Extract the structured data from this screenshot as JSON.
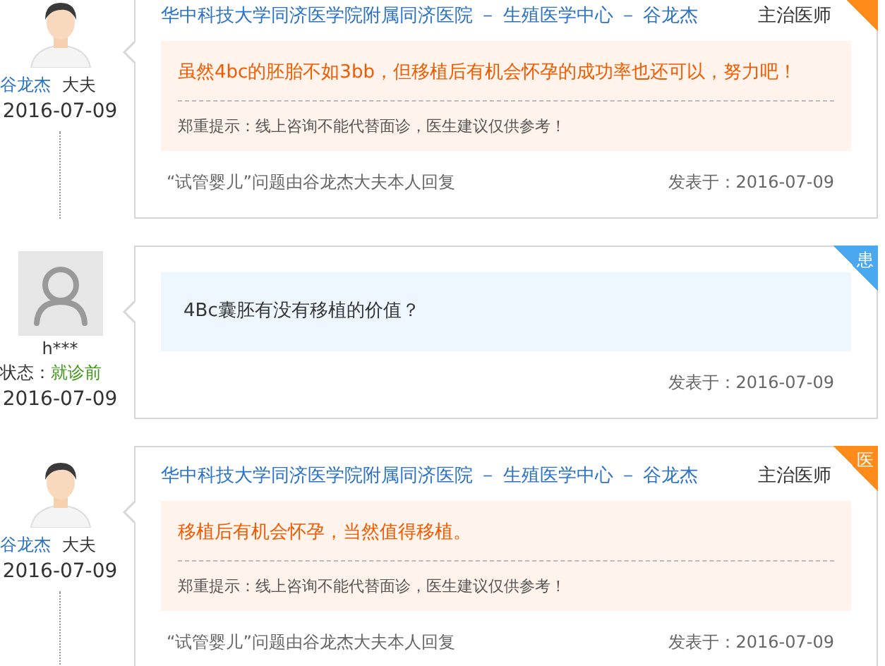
{
  "entries": [
    {
      "kind": "doctor",
      "name": "谷龙杰",
      "role": "大夫",
      "date": "2016-07-09",
      "hospital": "华中科技大学同济医学院附属同济医院 － 生殖医学中心 － 谷龙杰",
      "title": "主治医师",
      "answer": "虽然4bc的胚胎不如3bb，但移植后有机会怀孕的成功率也还可以，努力吧！",
      "notice": "郑重提示：线上咨询不能代替面诊，医生建议仅供参考！",
      "footer": "“试管婴儿”问题由谷龙杰大夫本人回复",
      "posted_label": "发表于：",
      "posted_date": "2016-07-09"
    },
    {
      "kind": "patient",
      "name": "h***",
      "status_label": "状态：",
      "status": "就诊前",
      "date": "2016-07-09",
      "badge": "患",
      "question": "4Bc囊胚有没有移植的价值？",
      "posted_label": "发表于：",
      "posted_date": "2016-07-09"
    },
    {
      "kind": "doctor",
      "name": "谷龙杰",
      "role": "大夫",
      "date": "2016-07-09",
      "badge": "医",
      "hospital": "华中科技大学同济医学院附属同济医院 － 生殖医学中心 － 谷龙杰",
      "title": "主治医师",
      "answer": "移植后有机会怀孕，当然值得移植。",
      "notice": "郑重提示：线上咨询不能代替面诊，医生建议仅供参考！",
      "footer": "“试管婴儿”问题由谷龙杰大夫本人回复",
      "posted_label": "发表于：",
      "posted_date": "2016-07-09"
    }
  ]
}
